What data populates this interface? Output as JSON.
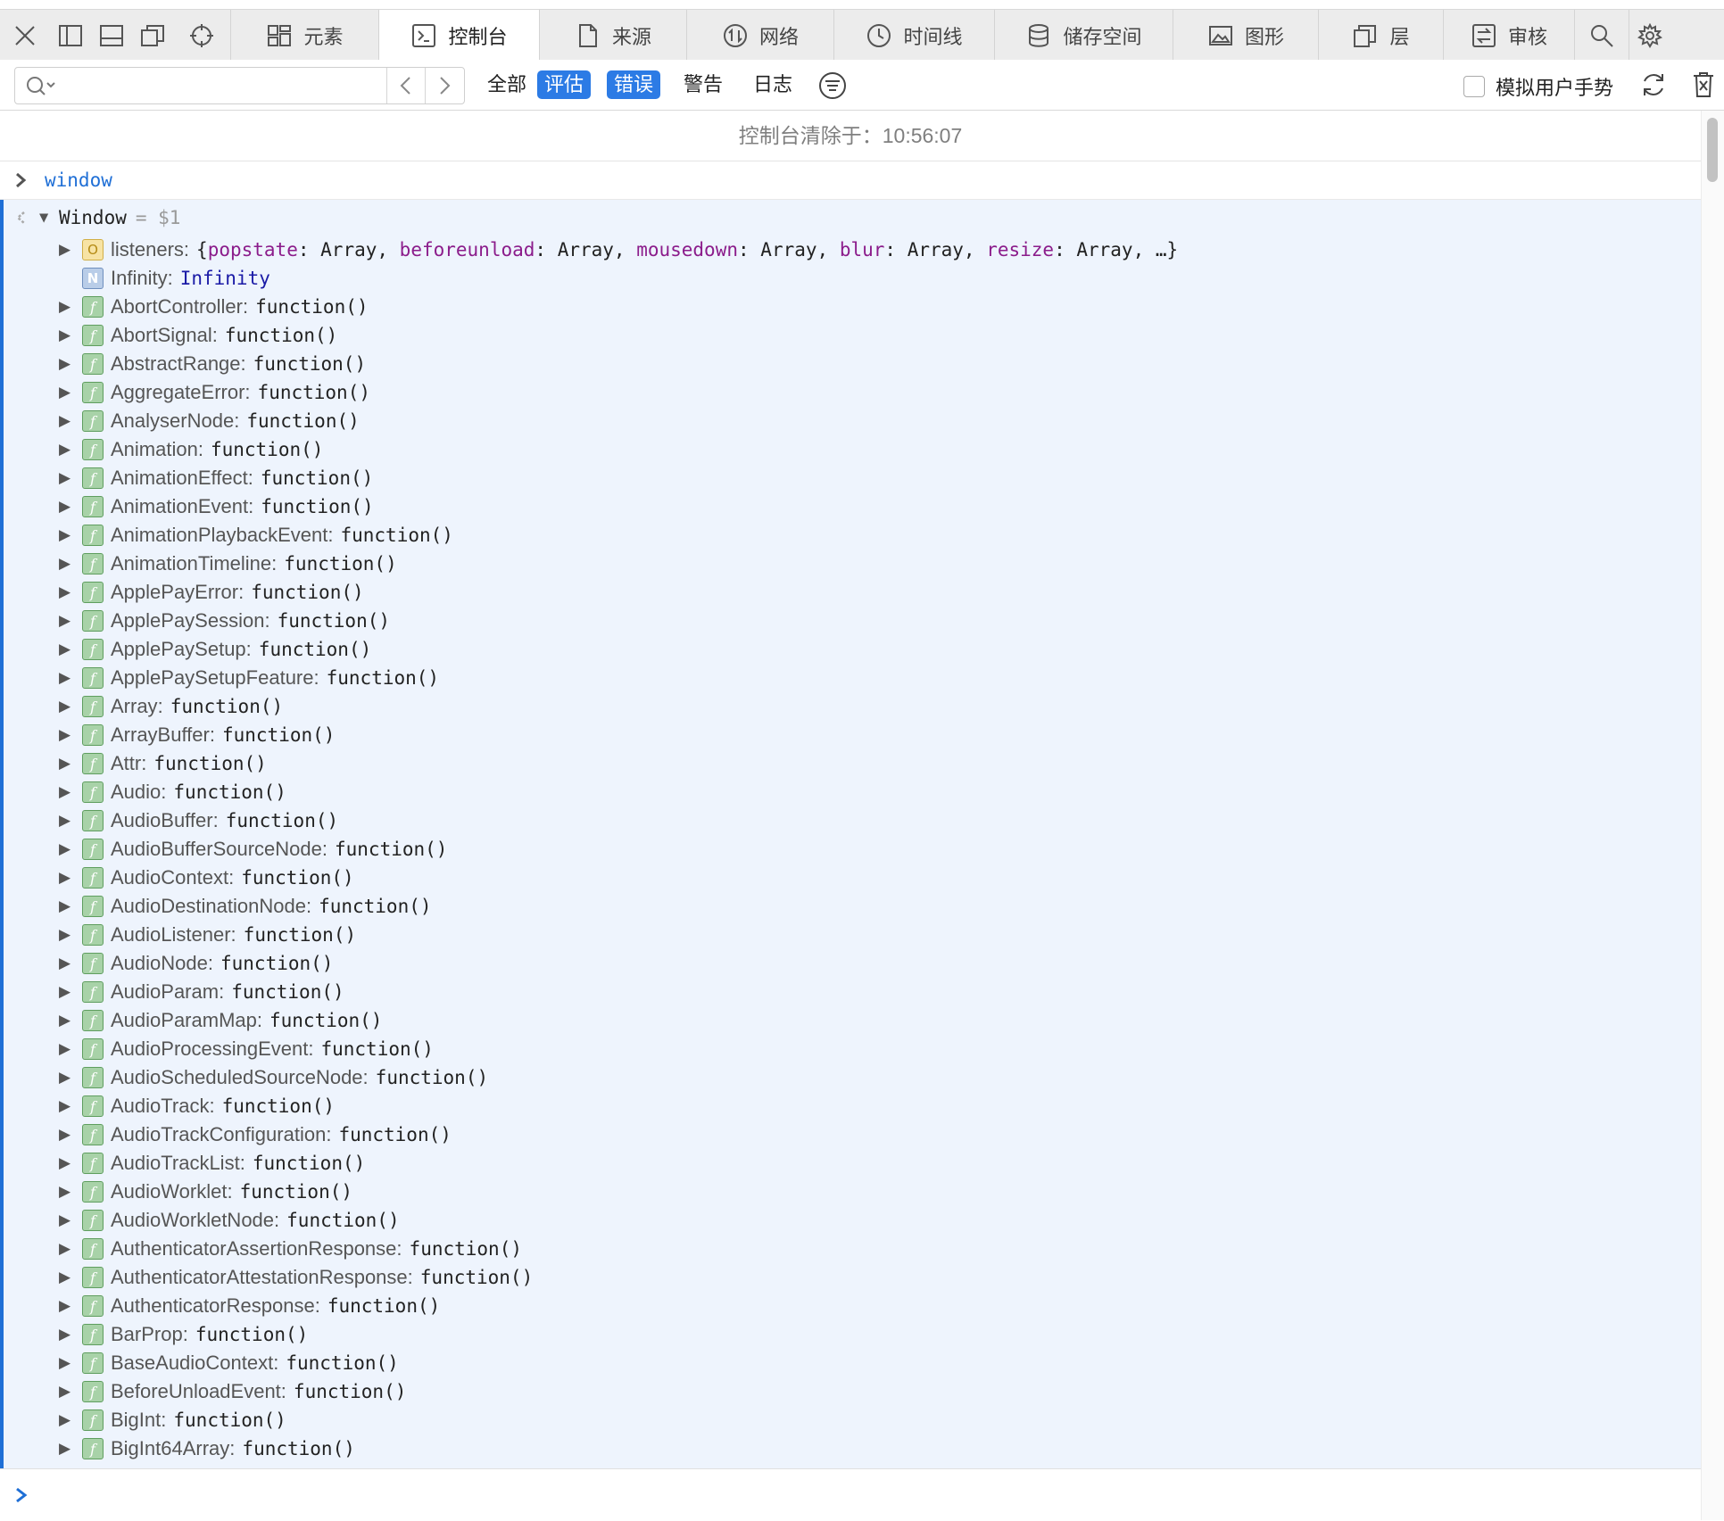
{
  "tabs": [
    {
      "id": "elements",
      "label": "元素",
      "icon": "layout-icon",
      "width": 166
    },
    {
      "id": "console",
      "label": "控制台",
      "icon": "console-icon",
      "width": 180,
      "active": true
    },
    {
      "id": "sources",
      "label": "来源",
      "icon": "document-icon",
      "width": 165
    },
    {
      "id": "network",
      "label": "网络",
      "icon": "network-icon",
      "width": 165
    },
    {
      "id": "timelines",
      "label": "时间线",
      "icon": "clock-icon",
      "width": 180
    },
    {
      "id": "storage",
      "label": "储存空间",
      "icon": "database-icon",
      "width": 200
    },
    {
      "id": "graphics",
      "label": "图形",
      "icon": "image-icon",
      "width": 163
    },
    {
      "id": "layers",
      "label": "层",
      "icon": "layers-icon",
      "width": 140
    },
    {
      "id": "audit",
      "label": "审核",
      "icon": "audit-icon",
      "width": 147
    }
  ],
  "filter": {
    "search_placeholder": "",
    "tabs": [
      {
        "label": "全部",
        "on": false
      },
      {
        "label": "评估",
        "on": true
      },
      {
        "label": "错误",
        "on": true
      },
      {
        "label": "警告",
        "on": false
      },
      {
        "label": "日志",
        "on": false
      }
    ],
    "simulate_gesture_label": "模拟用户手势"
  },
  "console": {
    "cleared_message": "控制台清除于：10:56:07",
    "input_expression": "window",
    "result_type": "Window",
    "result_var": "$1",
    "listeners": {
      "name": "listeners",
      "entries": [
        {
          "k": "popstate",
          "v": "Array"
        },
        {
          "k": "beforeunload",
          "v": "Array"
        },
        {
          "k": "mousedown",
          "v": "Array"
        },
        {
          "k": "blur",
          "v": "Array"
        },
        {
          "k": "resize",
          "v": "Array"
        }
      ],
      "more": "…"
    },
    "infinity": {
      "name": "Infinity",
      "value": "Infinity"
    },
    "function_value": "function()",
    "functions": [
      "AbortController",
      "AbortSignal",
      "AbstractRange",
      "AggregateError",
      "AnalyserNode",
      "Animation",
      "AnimationEffect",
      "AnimationEvent",
      "AnimationPlaybackEvent",
      "AnimationTimeline",
      "ApplePayError",
      "ApplePaySession",
      "ApplePaySetup",
      "ApplePaySetupFeature",
      "Array",
      "ArrayBuffer",
      "Attr",
      "Audio",
      "AudioBuffer",
      "AudioBufferSourceNode",
      "AudioContext",
      "AudioDestinationNode",
      "AudioListener",
      "AudioNode",
      "AudioParam",
      "AudioParamMap",
      "AudioProcessingEvent",
      "AudioScheduledSourceNode",
      "AudioTrack",
      "AudioTrackConfiguration",
      "AudioTrackList",
      "AudioWorklet",
      "AudioWorkletNode",
      "AuthenticatorAssertionResponse",
      "AuthenticatorAttestationResponse",
      "AuthenticatorResponse",
      "BarProp",
      "BaseAudioContext",
      "BeforeUnloadEvent",
      "BigInt",
      "BigInt64Array"
    ]
  },
  "colors": {
    "accent": "#2c7be5",
    "result_bg": "#eef4fd",
    "key_purple": "#8b1c8b"
  }
}
